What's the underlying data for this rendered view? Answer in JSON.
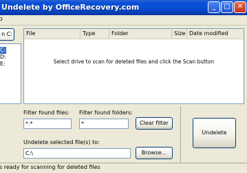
{
  "window": {
    "title": "Undelete by OfficeRecovery.com",
    "minimize": "_",
    "maximize": "□",
    "close": "✕"
  },
  "menu": {
    "items": [
      "p"
    ]
  },
  "left_panel": {
    "scan_button": "n C:",
    "drives": [
      "C:",
      "D:",
      "E:"
    ]
  },
  "file_list": {
    "columns": [
      "File",
      "Type",
      "Folder",
      "Size",
      "Date modified"
    ],
    "empty_message": "Select drive to scan for deleted files and click the Scan button"
  },
  "filters": {
    "files_label": "Filter found files:",
    "files_value": "*.*",
    "folders_label": "Filter found folders:",
    "folders_value": "*",
    "clear_button": "Clear filter"
  },
  "undelete_to": {
    "label": "Undelete selected file(s) to:",
    "value": "C:\\",
    "browse_button": "Browse..."
  },
  "undelete_button": "Undelete",
  "status": "s ready for scanning for deleted files",
  "colors": {
    "titlebar": "#0a4fd4",
    "window_bg": "#ece9d8",
    "selection": "#316ac5"
  }
}
